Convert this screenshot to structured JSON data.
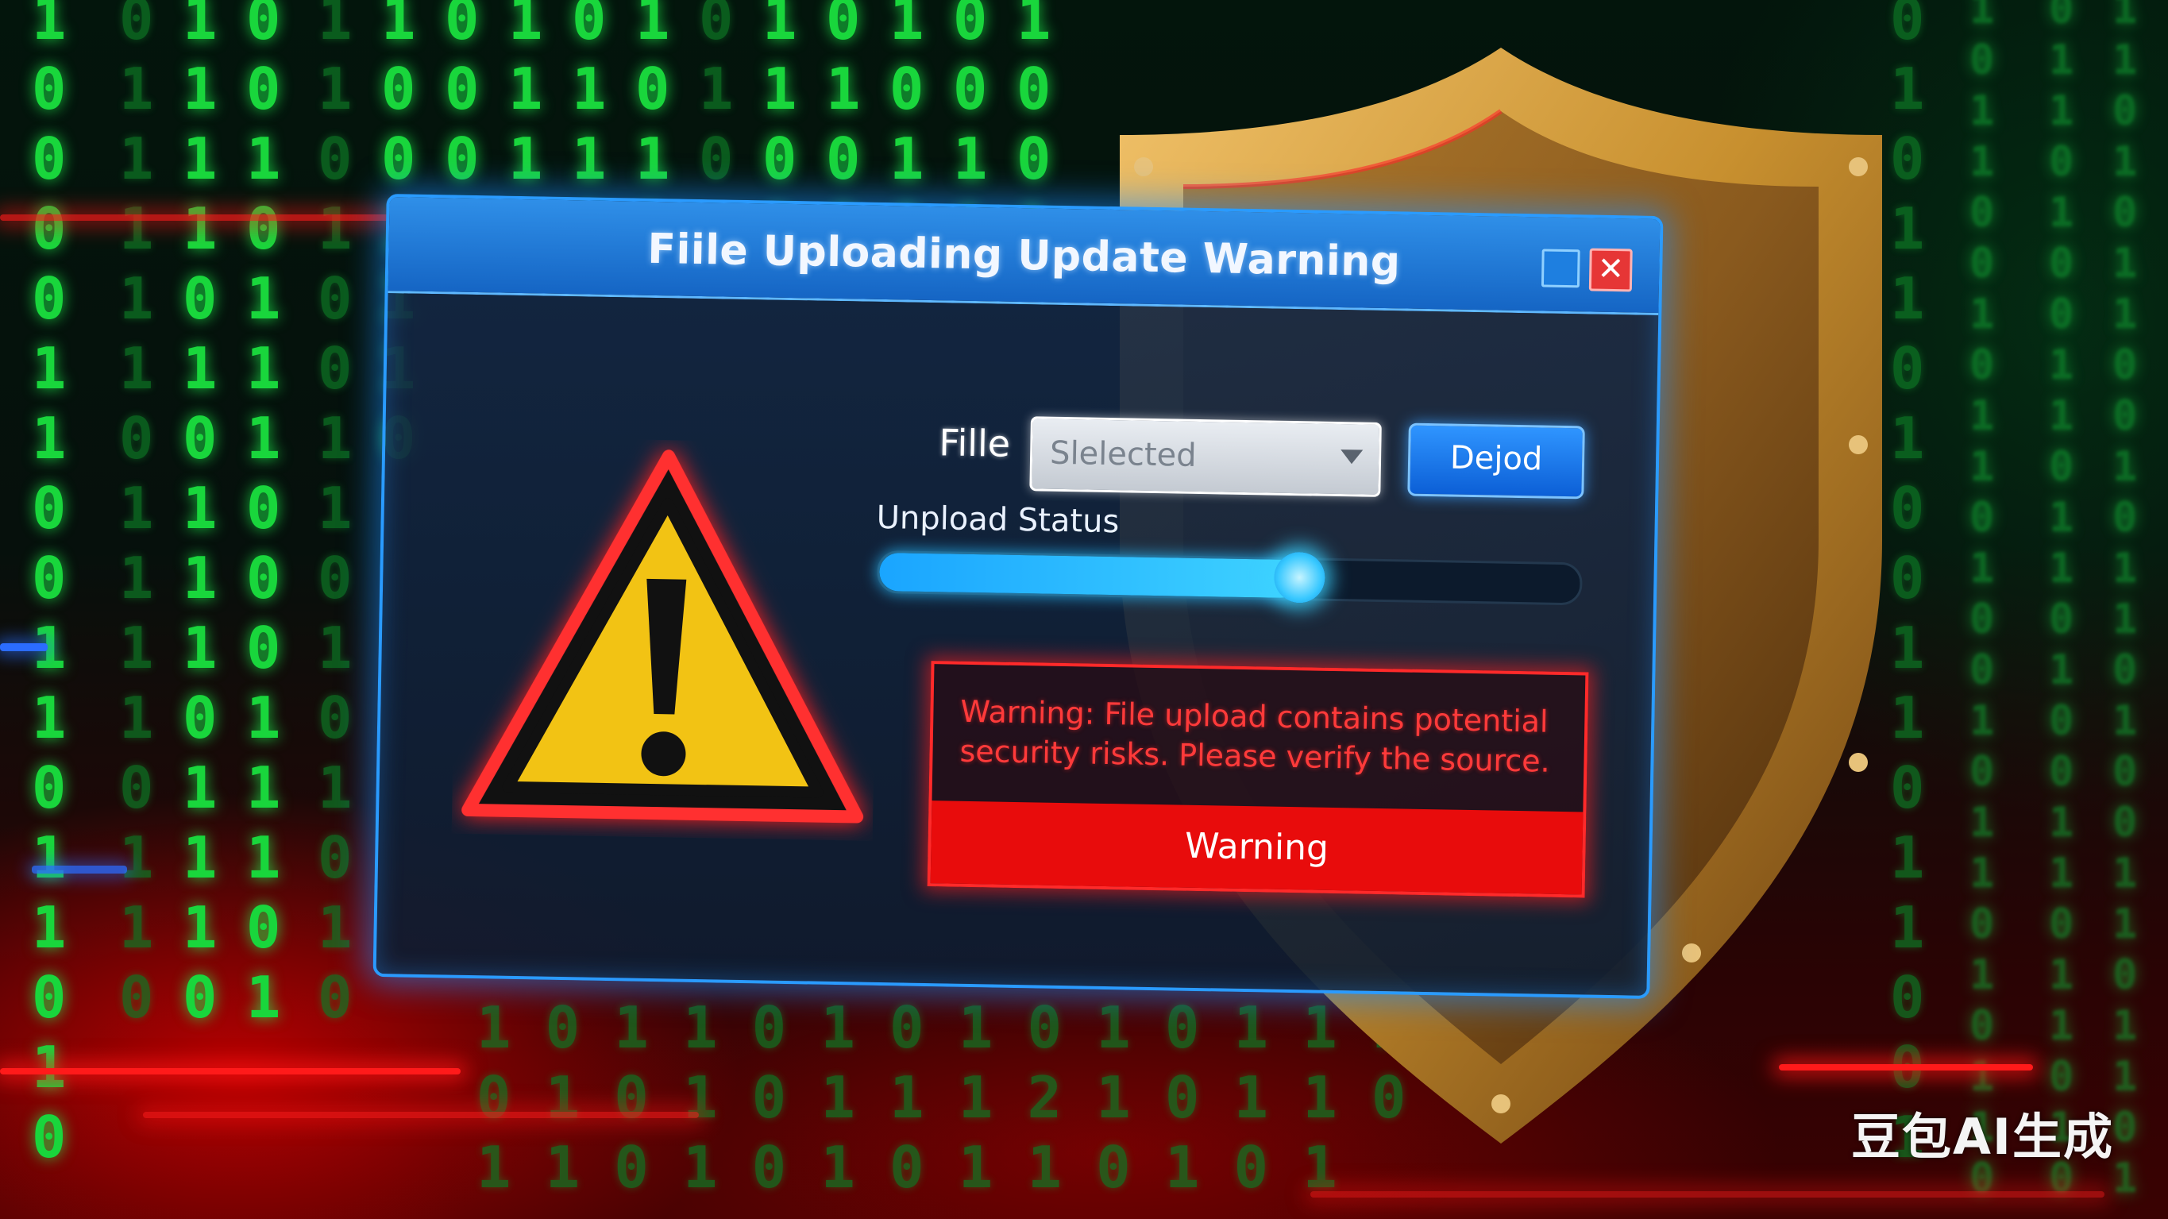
{
  "dialog": {
    "title": "Fiile Uploading Update Warning",
    "file_label": "Fille",
    "file_select_value": "Slelected",
    "action_button_label": "Dejod",
    "upload_status_label": "Unpload Status",
    "upload_progress_fraction": 0.6,
    "warning_message": "Warning: File upload contains potential security risks. Please verify the source.",
    "warning_button_label": "Warning",
    "close_glyph": "✕"
  },
  "watermark": "豆包AI生成",
  "icons": [
    "maximize-icon",
    "close-icon",
    "warning-triangle-icon",
    "chevron-down-icon",
    "shield-icon"
  ],
  "colors": {
    "accent_blue": "#2a9bff",
    "warning_red": "#e80c0c",
    "warning_text_red": "#ff3a3a",
    "triangle_yellow": "#f2c314",
    "binary_green": "#19d63c",
    "shield_gold": "#c8902f"
  }
}
